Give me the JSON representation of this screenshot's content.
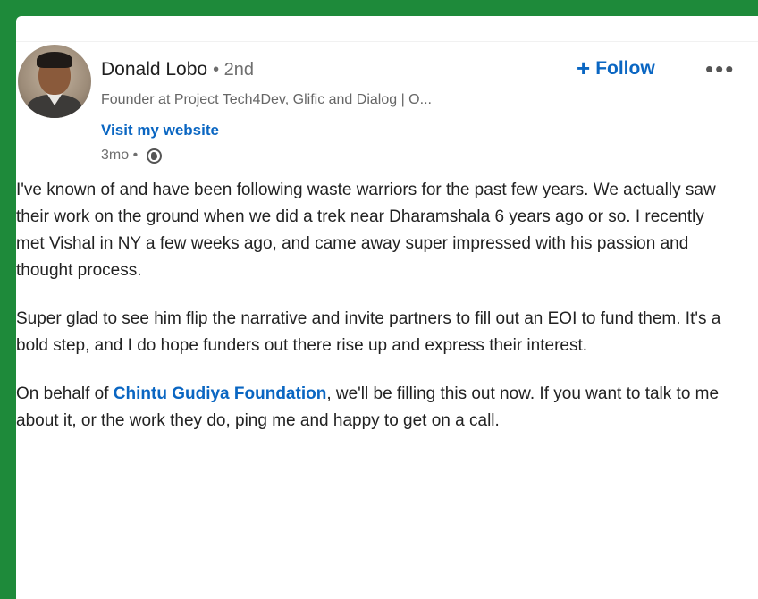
{
  "author": {
    "name": "Donald Lobo",
    "degree": "• 2nd",
    "headline": "Founder at Project Tech4Dev, Glific and Dialog | O...",
    "website_link": "Visit my website",
    "age": "3mo •"
  },
  "actions": {
    "follow_plus": "+",
    "follow_label": "Follow",
    "more_label": "•••"
  },
  "icons": {
    "visibility": "globe-icon"
  },
  "post": {
    "paragraph1": "I've known of and have been following waste warriors for the past few years. We actually saw their work on the ground when we did a trek near Dharamshala 6 years ago or so. I recently met Vishal in NY a few weeks ago, and came away super impressed with his passion and thought process.",
    "paragraph2": "Super glad to see him flip the narrative and invite partners to fill out an EOI to fund them. It's a bold step, and I do hope funders out there rise up and express their interest.",
    "paragraph3_prefix": "On behalf of ",
    "paragraph3_mention": "Chintu Gudiya Foundation",
    "paragraph3_suffix": ", we'll be filling this out now. If you want to talk to me about it, or the work they do, ping me and happy to get on a call."
  },
  "colors": {
    "frame_green": "#1e8a3a",
    "link_blue": "#0a66c2",
    "text": "#222222",
    "muted": "#6e6e6e"
  }
}
